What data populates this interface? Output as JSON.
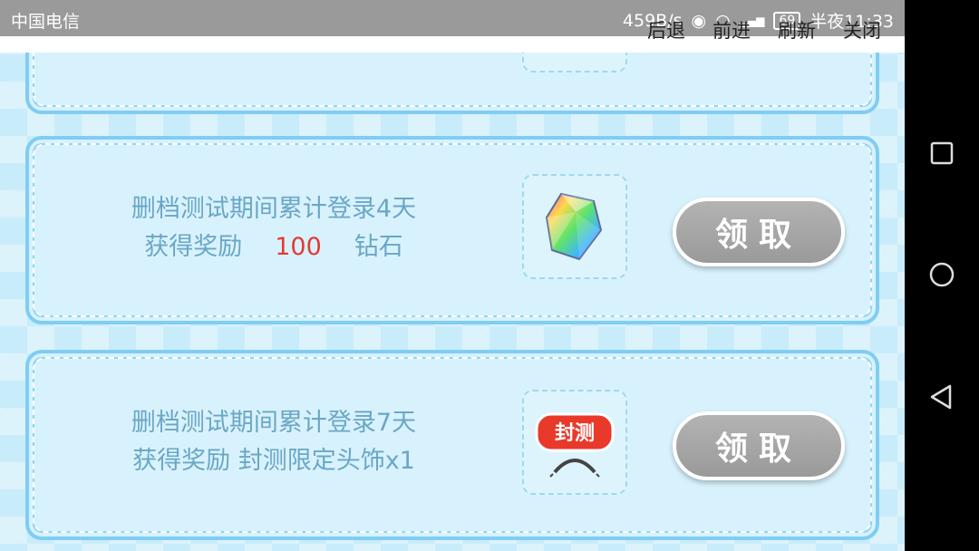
{
  "status_bar": {
    "carrier": "中国电信",
    "speed": "459B/s",
    "battery": "69",
    "time": "半夜11:33"
  },
  "browser_nav": {
    "back": "后退",
    "forward": "前进",
    "refresh": "刷新",
    "close": "关闭"
  },
  "rewards": [
    {
      "line1": "删档测试期间累计登录4天",
      "prefix": "获得奖励",
      "amount": "100",
      "item": "钻石",
      "button": "领取",
      "icon": "diamond-icon"
    },
    {
      "line1": "删档测试期间累计登录7天",
      "line2": "获得奖励  封测限定头饰x1",
      "button": "领取",
      "icon": "headband-icon",
      "badge_text": "封测"
    }
  ],
  "colors": {
    "amount": "#e53935",
    "text": "#6aa7c5",
    "button": "#a8a8a8"
  }
}
